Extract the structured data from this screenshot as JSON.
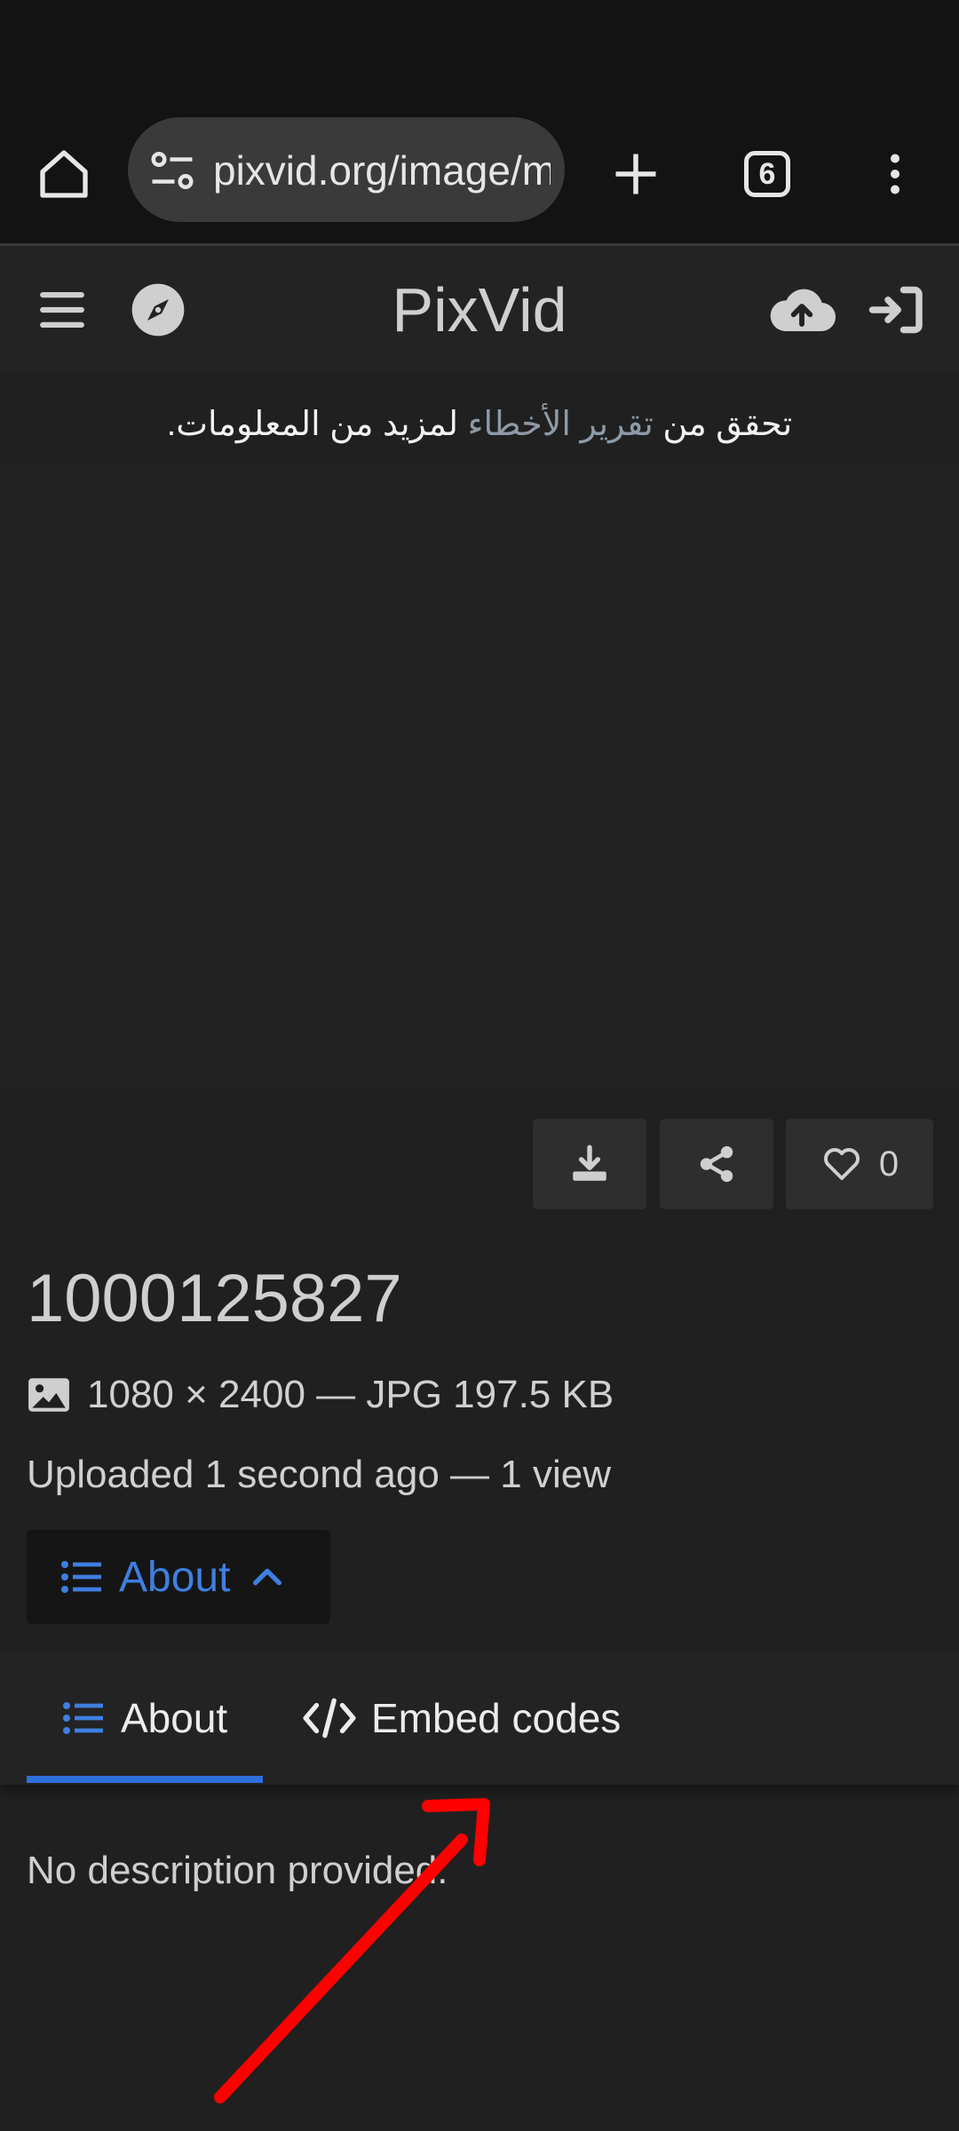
{
  "browser": {
    "url": "pixvid.org/image/m",
    "tab_count": "6"
  },
  "site": {
    "title": "PixVid"
  },
  "notice": {
    "prefix": "تحقق من ",
    "link": "تقرير الأخطاء",
    "suffix": " لمزيد من المعلومات."
  },
  "actions": {
    "like_count": "0"
  },
  "image": {
    "title": "1000125827",
    "meta": "1080 × 2400 — JPG 197.5 KB",
    "uploaded": "Uploaded 1 second ago — 1 view"
  },
  "about_toggle": {
    "label": "About"
  },
  "tabs": [
    {
      "label": "About",
      "active": true
    },
    {
      "label": "Embed codes",
      "active": false
    }
  ],
  "content": {
    "description": "No description provided."
  },
  "colors": {
    "accent": "#2f6fdc",
    "link": "#3f7fe0",
    "annotation_arrow": "#ff0000"
  }
}
